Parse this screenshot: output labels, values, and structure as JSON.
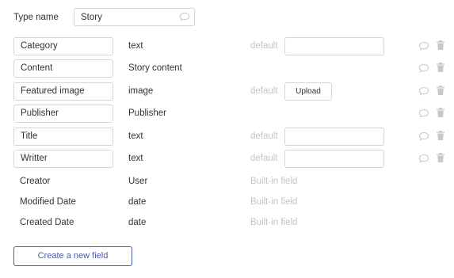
{
  "type_header": {
    "label": "Type name",
    "value": "Story",
    "comment_icon": "speech-bubble-icon"
  },
  "fields": [
    {
      "name": "Category",
      "type": "text",
      "default_label": "default",
      "default_control": "input"
    },
    {
      "name": "Content",
      "type": "Story content"
    },
    {
      "name": "Featured image",
      "type": "image",
      "default_label": "default",
      "default_control": "upload",
      "upload_label": "Upload"
    },
    {
      "name": "Publisher",
      "type": "Publisher"
    },
    {
      "name": "Title",
      "type": "text",
      "default_label": "default",
      "default_control": "input"
    },
    {
      "name": "Writter",
      "type": "text",
      "default_label": "default",
      "default_control": "input"
    }
  ],
  "builtin_fields": [
    {
      "name": "Creator",
      "type": "User",
      "note": "Built-in field"
    },
    {
      "name": "Modified Date",
      "type": "date",
      "note": "Built-in field"
    },
    {
      "name": "Created Date",
      "type": "date",
      "note": "Built-in field"
    }
  ],
  "row_icons": {
    "comment": "speech-bubble-icon",
    "delete": "trash-icon"
  },
  "create_button": {
    "label": "Create a new field"
  },
  "colors": {
    "accent": "#4a5ba8",
    "muted": "#c4c4c4",
    "border": "#d6d6d6",
    "icon": "#c8c8c8"
  }
}
